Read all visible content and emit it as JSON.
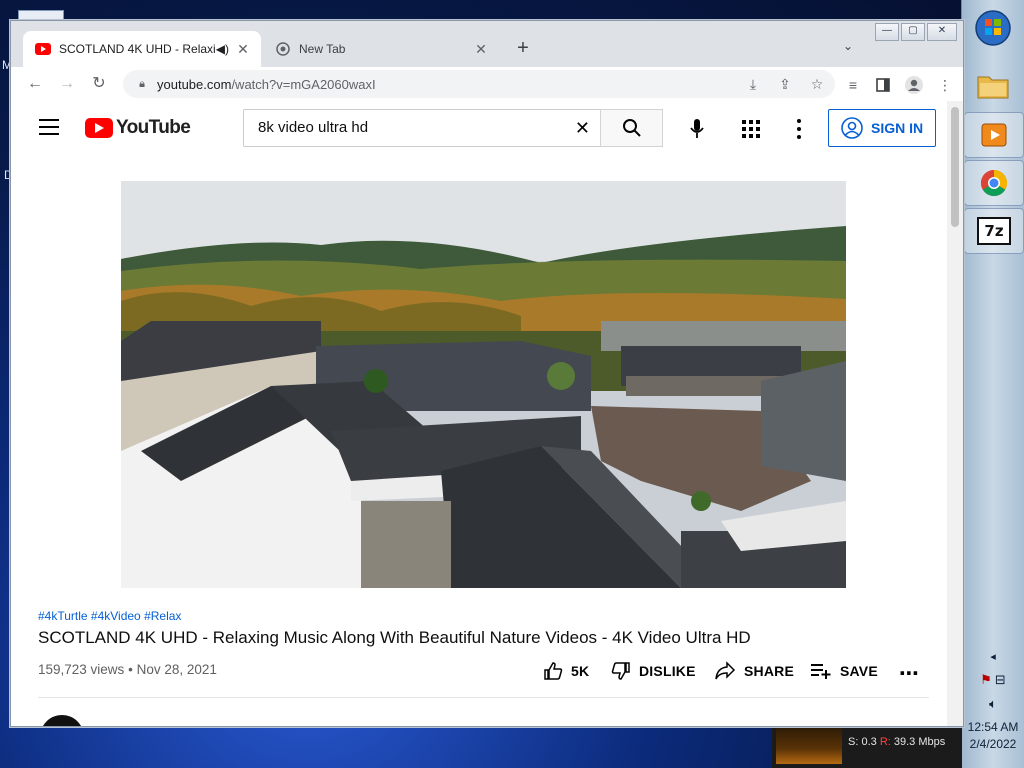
{
  "browser": {
    "tabs": [
      {
        "title": "SCOTLAND 4K UHD - Relaxin",
        "active": true
      },
      {
        "title": "New Tab",
        "active": false
      }
    ],
    "url_host": "youtube.com",
    "url_path": "/watch?v=mGA2060waxI"
  },
  "youtube": {
    "logo_text": "YouTube",
    "search_query": "8k video ultra hd",
    "sign_in_label": "SIGN IN"
  },
  "video": {
    "hashtags": "#4kTurtle #4kVideo #Relax",
    "title": "SCOTLAND 4K UHD - Relaxing Music Along With Beautiful Nature Videos - 4K Video Ultra HD",
    "views": "159,723 views",
    "separator": "•",
    "date": "Nov 28, 2021",
    "like_count": "5K",
    "dislike_label": "DISLIKE",
    "share_label": "SHARE",
    "save_label": "SAVE"
  },
  "system": {
    "time": "12:54 AM",
    "date": "2/4/2022",
    "net_stats": "S: 0.3",
    "net_r_label": "R:",
    "net_r_value": "39.3 Mbps"
  },
  "colors": {
    "youtube_red": "#ff0000",
    "link_blue": "#065fd4"
  }
}
